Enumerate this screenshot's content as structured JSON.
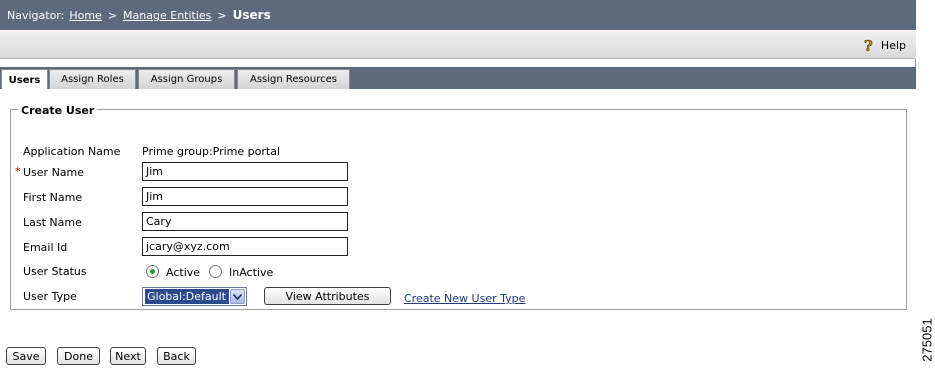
{
  "navigator": {
    "prefix": "Navigator:",
    "crumbs": [
      "Home",
      "Manage Entities"
    ],
    "separator": ">",
    "current": "Users"
  },
  "help": {
    "label": "Help",
    "icon": "help-question-icon"
  },
  "tabs": [
    {
      "label": "Users",
      "active": true
    },
    {
      "label": "Assign Roles",
      "active": false
    },
    {
      "label": "Assign Groups",
      "active": false
    },
    {
      "label": "Assign Resources",
      "active": false
    }
  ],
  "form": {
    "title": "Create User",
    "application_name": {
      "label": "Application Name",
      "value": "Prime group:Prime portal"
    },
    "user_name": {
      "label": "User Name",
      "value": "Jim",
      "required_marker": "*"
    },
    "first_name": {
      "label": "First Name",
      "value": "Jim"
    },
    "last_name": {
      "label": "Last Name",
      "value": "Cary"
    },
    "email": {
      "label": "Email Id",
      "value": "jcary@xyz.com"
    },
    "user_status": {
      "label": "User Status",
      "options": [
        "Active",
        "InActive"
      ],
      "selected": "Active"
    },
    "user_type": {
      "label": "User Type",
      "selected": "Global:Default",
      "view_attributes_label": "View Attributes",
      "create_link_label": "Create New User Type"
    }
  },
  "buttons": {
    "save": "Save",
    "done": "Done",
    "next": "Next",
    "back": "Back"
  },
  "figure_number": "275051",
  "colors": {
    "navbar": "#5d6a7e",
    "select_highlight": "#2d4a8f",
    "radio_on": "#2c9b2c",
    "required": "#c00000"
  }
}
